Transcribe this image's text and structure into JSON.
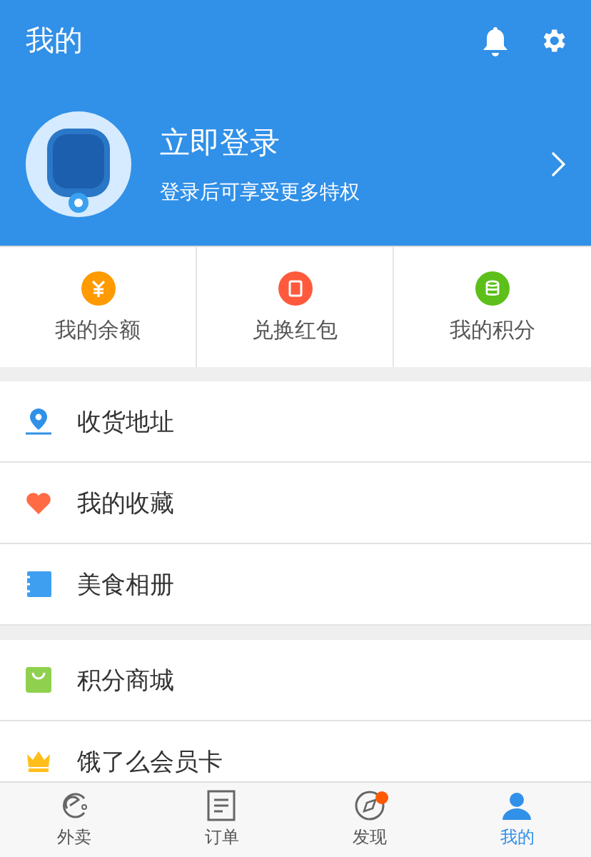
{
  "header": {
    "title": "我的"
  },
  "profile": {
    "title": "立即登录",
    "subtitle": "登录后可享受更多特权"
  },
  "quick_actions": [
    {
      "kind": "yuan",
      "label": "我的余额",
      "color": "#ff9a00"
    },
    {
      "kind": "packet",
      "label": "兑换红包",
      "color": "#ff5a3c"
    },
    {
      "kind": "coins",
      "label": "我的积分",
      "color": "#5cbf1a"
    }
  ],
  "menu_groups": [
    [
      {
        "kind": "pin",
        "label": "收货地址"
      },
      {
        "kind": "heart",
        "label": "我的收藏"
      },
      {
        "kind": "album",
        "label": "美食相册"
      }
    ],
    [
      {
        "kind": "bag",
        "label": "积分商城"
      },
      {
        "kind": "crown",
        "label": "饿了么会员卡"
      }
    ]
  ],
  "tab_bar": [
    {
      "kind": "takeout",
      "label": "外卖",
      "selected": false,
      "badge": false
    },
    {
      "kind": "orders",
      "label": "订单",
      "selected": false,
      "badge": false
    },
    {
      "kind": "discover",
      "label": "发现",
      "selected": false,
      "badge": true
    },
    {
      "kind": "me",
      "label": "我的",
      "selected": true,
      "badge": false
    }
  ]
}
